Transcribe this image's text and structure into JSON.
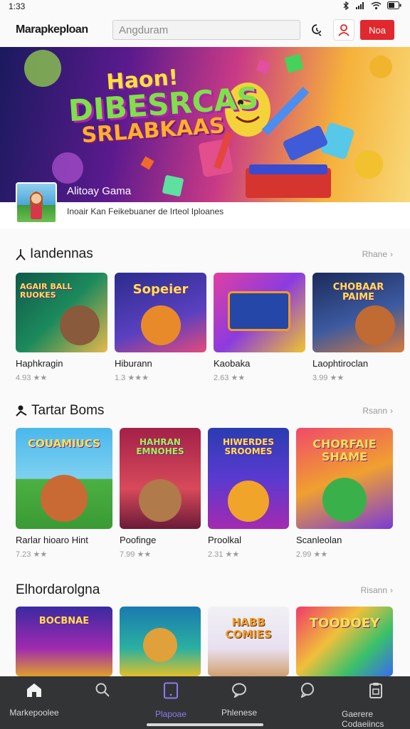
{
  "status": {
    "time": "1:33"
  },
  "header": {
    "app_name": "Marapkeploan",
    "search_placeholder": "Angduram",
    "cta_label": "Noa"
  },
  "hero": {
    "title_lines": [
      "Haon!",
      "DIBESRCAS",
      "SRLABKAAS"
    ],
    "app_name": "Alitoay Gama",
    "description": "Inoair Kan Feikebuaner de Irteol Iploanes"
  },
  "sections": [
    {
      "title": "Iandennas",
      "more_label": "Rhane",
      "items": [
        {
          "art_text": "AGAIR BALL RUOKES",
          "name": "Haphkragin",
          "rating": "4.93"
        },
        {
          "art_text": "Sopeier",
          "name": "Hiburann",
          "rating": "1.3"
        },
        {
          "art_text": "",
          "name": "Kaobaka",
          "rating": "2.63"
        },
        {
          "art_text": "CHOBAAR PAIME",
          "name": "Laophtiroclan",
          "rating": "3.99"
        }
      ]
    },
    {
      "title": "Tartar Boms",
      "more_label": "Rsann",
      "items": [
        {
          "art_text": "COUAMIUCS",
          "name": "Rarlar hioaro Hint",
          "rating": "7.23"
        },
        {
          "art_text": "HAHRAN EMNOHES",
          "name": "Poofinge",
          "rating": "7.99"
        },
        {
          "art_text": "HIWERDES SROOMES",
          "name": "Proolkal",
          "rating": "2.31"
        },
        {
          "art_text": "CHORFAIE SHAME",
          "name": "Scanleolan",
          "rating": "2.99"
        }
      ]
    },
    {
      "title": "Elhordarolgna",
      "more_label": "Risann",
      "items": [
        {
          "art_text": "BOCBNAE",
          "name": "",
          "rating": ""
        },
        {
          "art_text": "",
          "name": "",
          "rating": ""
        },
        {
          "art_text": "HABB COMIES",
          "name": "",
          "rating": ""
        },
        {
          "art_text": "TOODOEY",
          "name": "",
          "rating": ""
        }
      ]
    }
  ],
  "nav": [
    {
      "label": "Markepoolee",
      "icon": "home-icon"
    },
    {
      "label": "",
      "icon": "search-icon"
    },
    {
      "label": "Plapoae",
      "icon": "tablet-icon",
      "active": true
    },
    {
      "label": "Phlenese",
      "icon": "chat-icon"
    },
    {
      "label": "",
      "icon": "bubble-icon"
    },
    {
      "label": "Gaerere Codaeiincs",
      "icon": "clipboard-icon"
    }
  ],
  "colors": {
    "accent": "#e0282e",
    "nav_active": "#8a7cf0",
    "nav_bg": "#333436"
  }
}
